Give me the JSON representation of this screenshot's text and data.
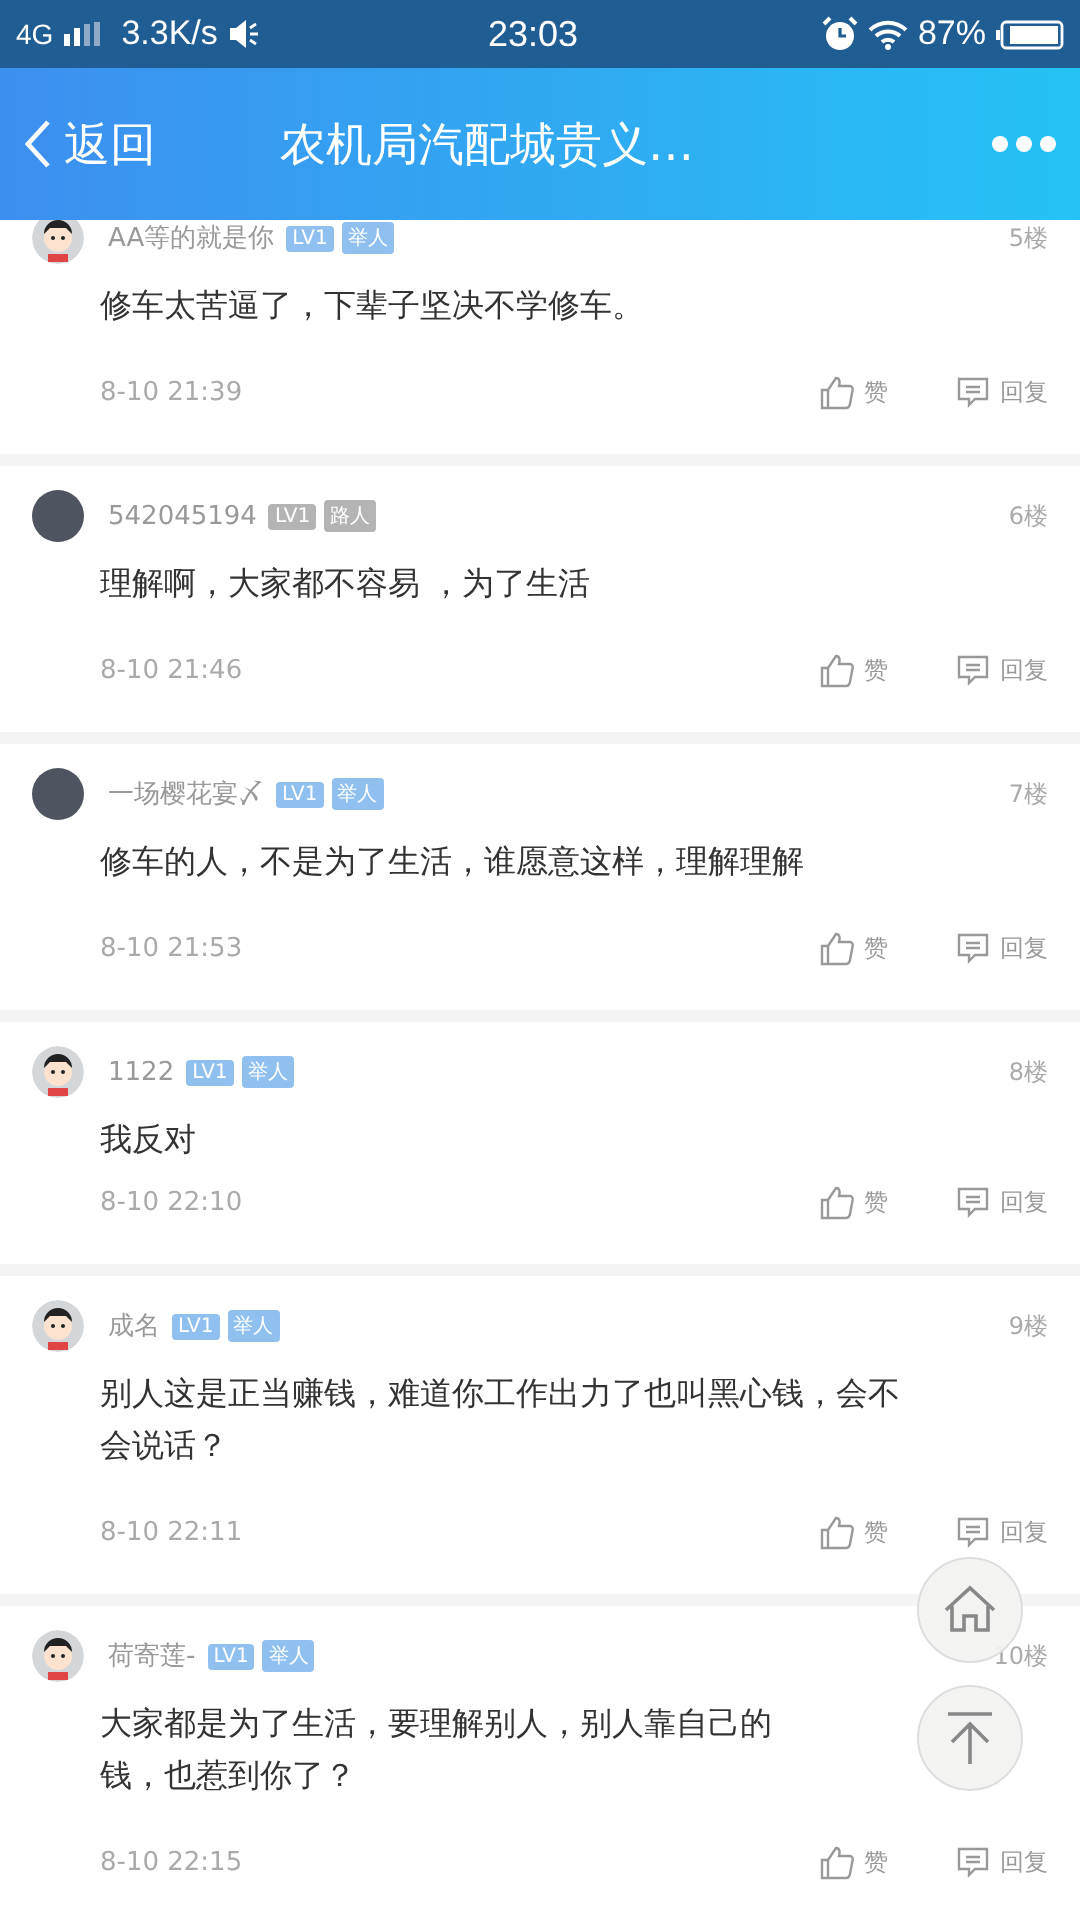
{
  "status_bar": {
    "network": "4G",
    "speed": "3.3K/s",
    "time": "23:03",
    "battery": "87%"
  },
  "header": {
    "back": "返回",
    "title": "农机局汽配城贵义…"
  },
  "comments": [
    {
      "name": "AA等的就是你",
      "badges": [
        {
          "text": "LV1",
          "color": "#8fc0ef"
        },
        {
          "text": "举人",
          "color": "#8fc0ef"
        }
      ],
      "floor": "5楼",
      "lines": [
        "修车太苦逼了，下辈子坚决不学修车。"
      ],
      "time": "8-10 21:39",
      "like": "赞",
      "reply": "回复",
      "kind": "cartoon"
    },
    {
      "name": "542045194",
      "badges": [
        {
          "text": "LV1",
          "color": "#b4b4b4"
        },
        {
          "text": "路人",
          "color": "#b4b4b4"
        }
      ],
      "floor": "6楼",
      "lines": [
        "理解啊，大家都不容易 ，为了生活"
      ],
      "time": "8-10 21:46",
      "like": "赞",
      "reply": "回复",
      "kind": "photo"
    },
    {
      "name": "一场樱花宴〆",
      "badges": [
        {
          "text": "LV1",
          "color": "#8fc0ef"
        },
        {
          "text": "举人",
          "color": "#8fc0ef"
        }
      ],
      "floor": "7楼",
      "lines": [
        "修车的人，不是为了生活，谁愿意这样，理解理解"
      ],
      "time": "8-10 21:53",
      "like": "赞",
      "reply": "回复",
      "kind": "photo"
    },
    {
      "name": "1122",
      "badges": [
        {
          "text": "LV1",
          "color": "#8fc0ef"
        },
        {
          "text": "举人",
          "color": "#8fc0ef"
        }
      ],
      "floor": "8楼",
      "lines": [
        "我反对"
      ],
      "time": "8-10 22:10",
      "like": "赞",
      "reply": "回复",
      "kind": "cartoon"
    },
    {
      "name": "成名",
      "badges": [
        {
          "text": "LV1",
          "color": "#8fc0ef"
        },
        {
          "text": "举人",
          "color": "#8fc0ef"
        }
      ],
      "floor": "9楼",
      "lines": [
        "别人这是正当赚钱，难道你工作出力了也叫黑心钱，会不",
        "会说话？"
      ],
      "time": "8-10 22:11",
      "like": "赞",
      "reply": "回复",
      "kind": "cartoon"
    },
    {
      "name": "荷寄莲-",
      "badges": [
        {
          "text": "LV1",
          "color": "#8fc0ef"
        },
        {
          "text": "举人",
          "color": "#8fc0ef"
        }
      ],
      "floor": "10楼",
      "lines": [
        "大家都是为了生活，要理解别人，别人靠自己的",
        "钱，也惹到你了？"
      ],
      "time": "8-10 22:15",
      "like": "赞",
      "reply": "回复",
      "kind": "cartoon"
    }
  ]
}
